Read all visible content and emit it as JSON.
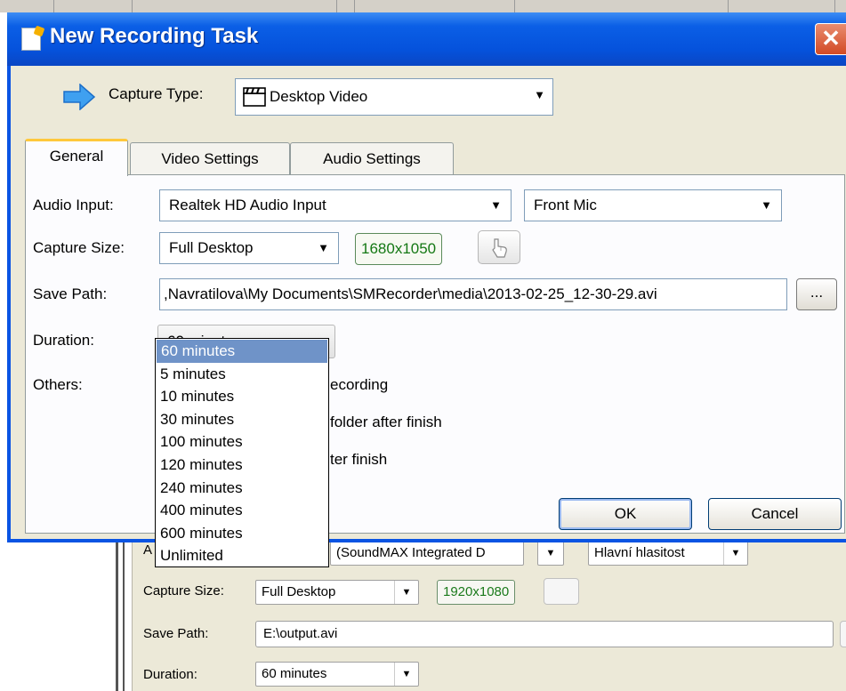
{
  "window": {
    "title": "New Recording Task",
    "close_glyph": "✕"
  },
  "capture": {
    "label": "Capture Type:",
    "value": "Desktop Video"
  },
  "tabs": [
    {
      "label": "General",
      "active": true
    },
    {
      "label": "Video Settings",
      "active": false
    },
    {
      "label": "Audio Settings",
      "active": false
    }
  ],
  "general": {
    "audio_input_label": "Audio Input:",
    "audio_device": "Realtek HD Audio Input",
    "audio_line": "Front Mic",
    "capture_size_label": "Capture Size:",
    "capture_size": "Full Desktop",
    "resolution": "1680x1050",
    "save_path_label": "Save Path:",
    "save_path": ",Navratilova\\My Documents\\SMRecorder\\media\\2013-02-25_12-30-29.avi",
    "browse_label": "...",
    "duration_label": "Duration:",
    "duration": "60 minutes",
    "others_label": "Others:",
    "others_fragments": [
      "ecording",
      "folder after finish",
      "ter finish"
    ]
  },
  "duration_options": [
    "60 minutes",
    "5 minutes",
    "10 minutes",
    "30 minutes",
    "100 minutes",
    "120 minutes",
    "240 minutes",
    "400 minutes",
    "600 minutes",
    "Unlimited"
  ],
  "duration_selected_index": 0,
  "buttons": {
    "ok": "OK",
    "cancel": "Cancel"
  },
  "background_window": {
    "audio_label_fragment": "A",
    "audio_device_fragment": "(SoundMAX Integrated D",
    "audio_line_fragment": "Hlavní hlasitost",
    "capture_size_label": "Capture Size:",
    "capture_size": "Full Desktop",
    "resolution": "1920x1080",
    "save_path_label": "Save Path:",
    "save_path": "E:\\output.avi",
    "duration_label": "Duration:",
    "duration": "60 minutes"
  },
  "colors": {
    "titlebar": "#0552dc",
    "dialog_bg": "#ece9d8",
    "selected_item": "#6f93c8",
    "resolution_text": "#147814",
    "tab_highlight": "#ffc83c"
  },
  "icons": {
    "title": "new-task-icon",
    "capture_type": "blue-arrow-icon",
    "capture_value": "clapperboard-icon",
    "picker": "hand-pointer-icon",
    "close": "close-icon"
  }
}
